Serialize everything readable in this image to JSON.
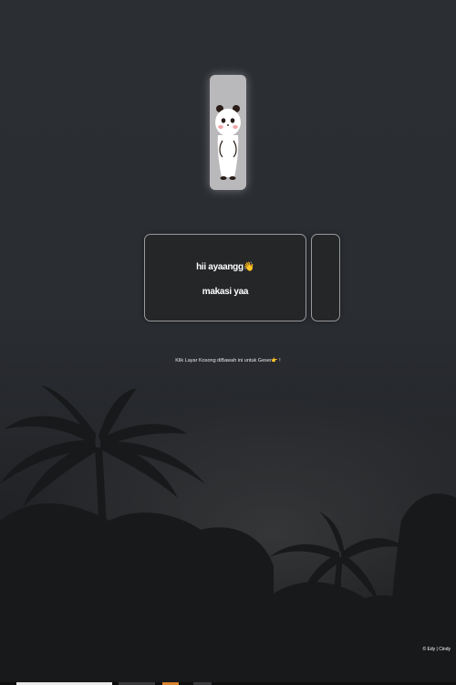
{
  "avatar": {
    "name": "panda-sticker-icon"
  },
  "messages": {
    "line1": "hii ayaangg👋",
    "line2": "makasi yaa"
  },
  "hint": "Klik Layar Kosong diBawah ini untuk Geser👉 !",
  "credit": "© Edy | Cindy",
  "colors": {
    "background": "#2a2d32",
    "card_border": "#9a9a9d",
    "card_bg": "#252628",
    "accent_orange": "#d9822b"
  }
}
